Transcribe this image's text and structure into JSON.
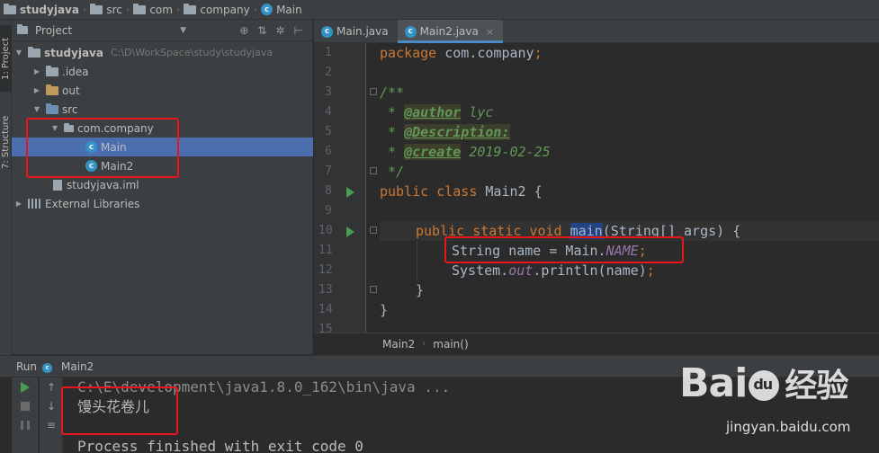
{
  "navbar": {
    "crumbs": [
      {
        "label": "studyjava",
        "icon": "project-folder-icon"
      },
      {
        "label": "src",
        "icon": "folder-icon"
      },
      {
        "label": "com",
        "icon": "folder-icon"
      },
      {
        "label": "company",
        "icon": "folder-icon"
      },
      {
        "label": "Main",
        "icon": "class-icon"
      }
    ]
  },
  "stripe": {
    "project_tab": "1: Project",
    "structure_tab": "7: Structure"
  },
  "project_panel": {
    "title": "Project",
    "tree": [
      {
        "label": "studyjava",
        "path": "C:\\D\\WorkSpace\\study\\studyjava",
        "expanded": true
      },
      {
        "label": ".idea",
        "expanded": false
      },
      {
        "label": "out",
        "expanded": false
      },
      {
        "label": "src",
        "expanded": true
      },
      {
        "label": "com.company",
        "expanded": true
      },
      {
        "label": "Main",
        "selected": true
      },
      {
        "label": "Main2"
      },
      {
        "label": "studyjava.iml"
      },
      {
        "label": "External Libraries",
        "expanded": false
      }
    ]
  },
  "editor": {
    "tabs": [
      {
        "label": "Main.java",
        "active": false
      },
      {
        "label": "Main2.java",
        "active": true
      }
    ],
    "line_numbers": [
      "1",
      "2",
      "3",
      "4",
      "5",
      "6",
      "7",
      "8",
      "9",
      "10",
      "11",
      "12",
      "13",
      "14",
      "15"
    ],
    "code": {
      "l1_kw": "package",
      "l1_rest": " com.company",
      "l1_semi": ";",
      "l3": "/**",
      "l4_star": " * ",
      "l4_tag": "@author",
      "l4_val": " lyc",
      "l5_star": " * ",
      "l5_tag": "@Description:",
      "l6_star": " * ",
      "l6_tag": "@create",
      "l6_val": " 2019-02-25",
      "l7": " */",
      "l8_kw": "public class",
      "l8_rest": " Main2 {",
      "l10_kw": "public static void",
      "l10_name": "main",
      "l10_rest": "(String[] args) {",
      "l11_a": "String name = Main.",
      "l11_field": "NAME",
      "l11_semi": ";",
      "l12_a": "System.",
      "l12_field": "out",
      "l12_b": ".println(name)",
      "l12_semi": ";",
      "l13": "}",
      "l14": "}"
    },
    "breadcrumb": [
      "Main2",
      "main()"
    ]
  },
  "run_panel": {
    "label": "Run",
    "config": "Main2",
    "console": [
      "C:\\E\\development\\java1.8.0_162\\bin\\java ...",
      "馒头花卷儿",
      "",
      "Process finished with exit code 0"
    ]
  },
  "watermark": {
    "logo_a": "Bai",
    "logo_cn": "经验",
    "url": "jingyan.baidu.com"
  },
  "colors": {
    "annotation": "#e8161a",
    "selection": "#4b6eaf",
    "keyword": "#cc7832",
    "comment": "#629755",
    "field": "#9876aa"
  }
}
